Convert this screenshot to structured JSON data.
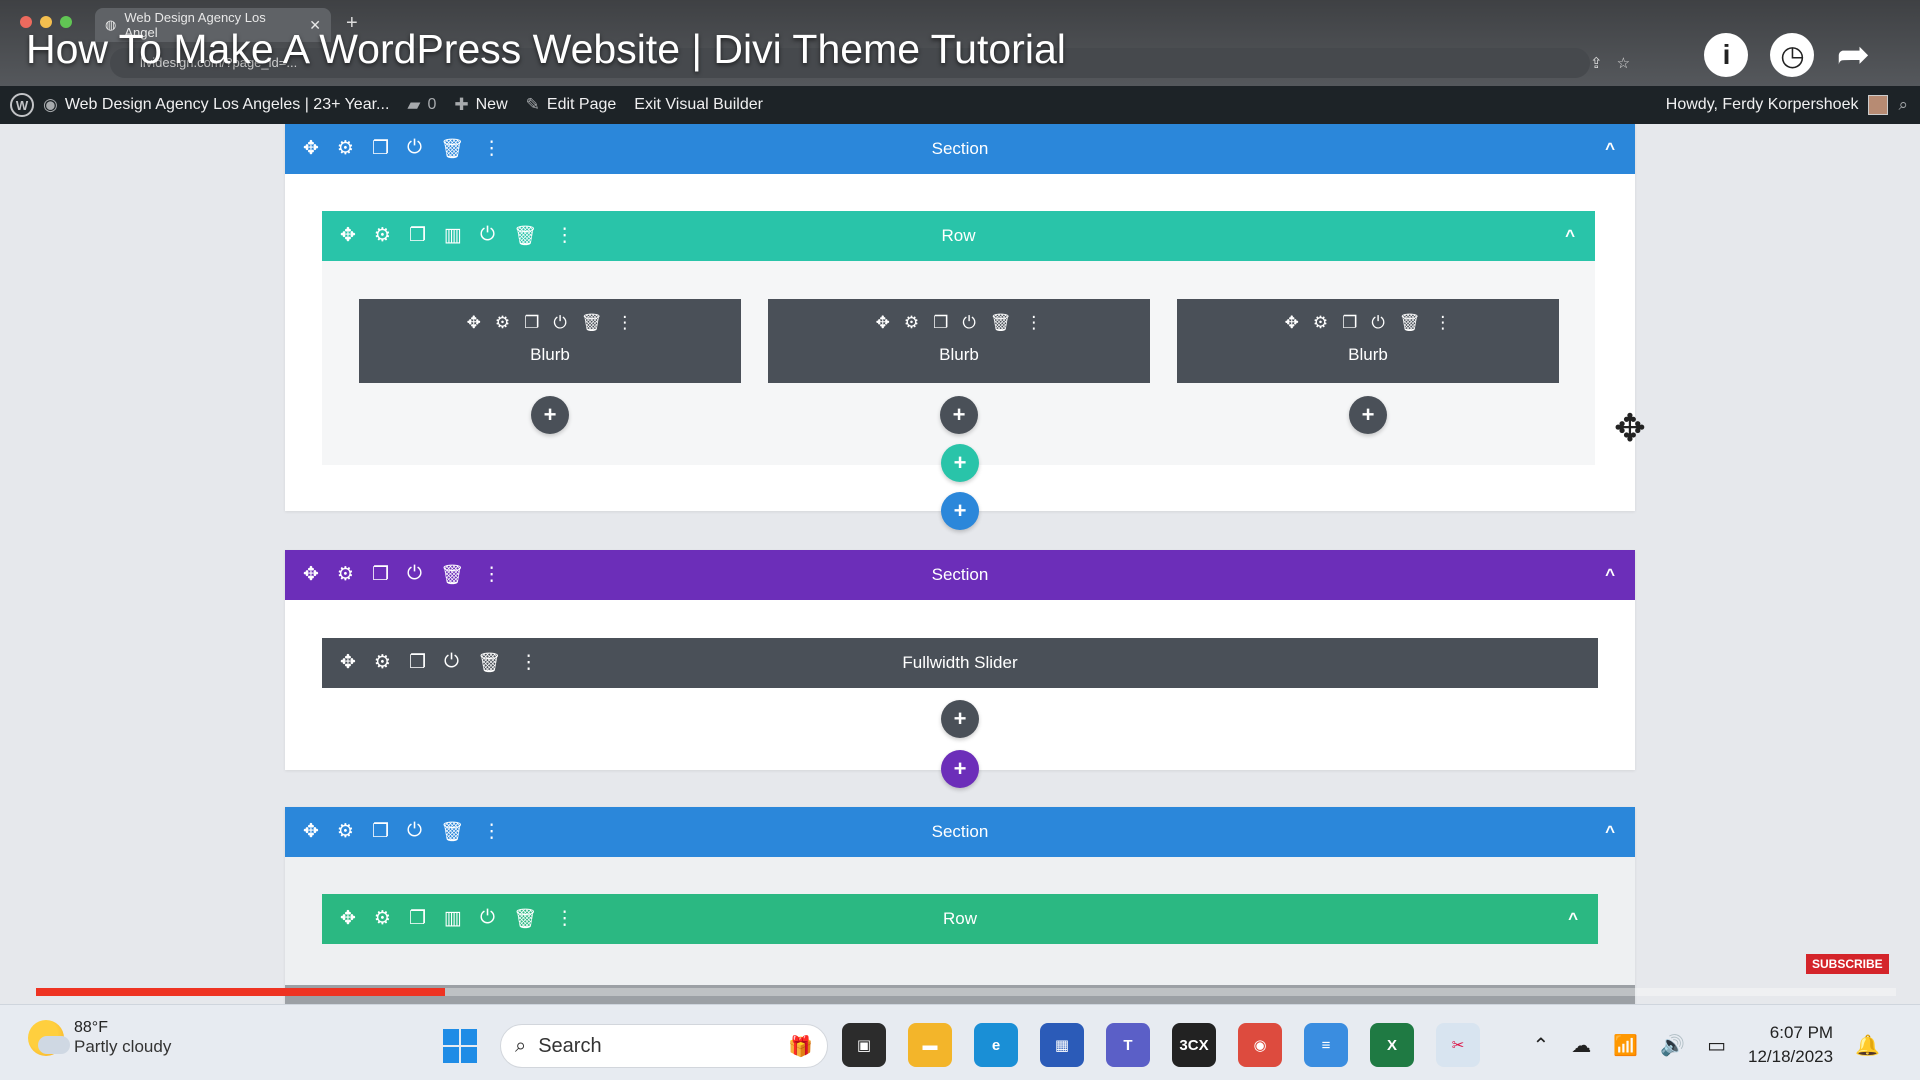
{
  "browser": {
    "tab_title": "Web Design Agency Los Angel",
    "url": "lividesign.com/?page_id=...",
    "video_title": "How To Make A WordPress Website | Divi Theme Tutorial"
  },
  "admin_bar": {
    "site_name": "Web Design Agency Los Angeles | 23+ Year...",
    "comments_count": "0",
    "new_label": "New",
    "edit_label": "Edit Page",
    "exit_label": "Exit Visual Builder",
    "howdy": "Howdy, Ferdy Korpershoek"
  },
  "builder": {
    "section1_label": "Section",
    "row1_label": "Row",
    "module_label": "Blurb",
    "section2_label": "Section",
    "slider_label": "Fullwidth Slider",
    "section3_label": "Section",
    "row3_label": "Row",
    "plus_symbol": "+",
    "chevron": "^"
  },
  "overlay": {
    "subscribe_label": "SUBSCRIBE",
    "progress_fraction": 0.22
  },
  "taskbar": {
    "temperature": "88°F",
    "weather": "Partly cloudy",
    "search_placeholder": "Search",
    "time": "6:07 PM",
    "date": "12/18/2023"
  },
  "colors": {
    "section_blue": "#2b87da",
    "section_purple": "#6c2eb9",
    "row_green": "#29c4a9",
    "module_dark": "#4a5058"
  }
}
